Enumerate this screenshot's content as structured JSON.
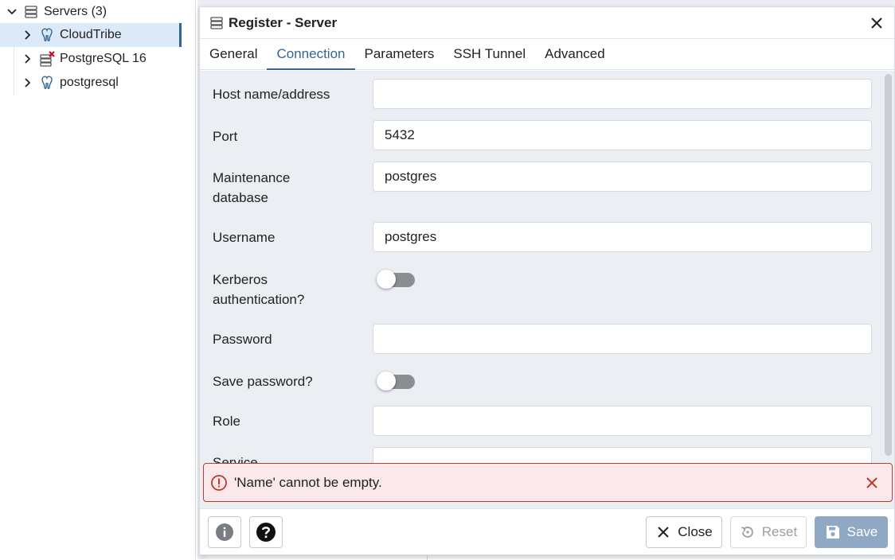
{
  "tree": {
    "root": {
      "label": "Servers (3)"
    },
    "items": [
      {
        "label": "CloudTribe",
        "selected": true
      },
      {
        "label": "PostgreSQL 16"
      },
      {
        "label": "postgresql"
      }
    ]
  },
  "dialog": {
    "title": "Register - Server",
    "tabs": [
      "General",
      "Connection",
      "Parameters",
      "SSH Tunnel",
      "Advanced"
    ],
    "active_tab": "Connection",
    "fields": {
      "host_label": "Host name/address",
      "host_value": "",
      "port_label": "Port",
      "port_value": "5432",
      "maintenance_db_label_1": "Maintenance",
      "maintenance_db_label_2": "database",
      "maintenance_db_value": "postgres",
      "username_label": "Username",
      "username_value": "postgres",
      "kerberos_label_1": "Kerberos",
      "kerberos_label_2": "authentication?",
      "kerberos_on": false,
      "password_label": "Password",
      "password_value": "",
      "save_password_label": "Save password?",
      "save_password_on": false,
      "role_label": "Role",
      "role_value": "",
      "service_label": "Service",
      "service_value": ""
    },
    "error": {
      "message": "'Name' cannot be empty."
    },
    "footer": {
      "close_label": "Close",
      "reset_label": "Reset",
      "save_label": "Save"
    }
  },
  "colors": {
    "accent": "#326690",
    "error_border": "#c0392b",
    "error_bg": "#fae8ea",
    "save_bg": "#8fa9c4",
    "form_bg": "#ebeef3"
  }
}
